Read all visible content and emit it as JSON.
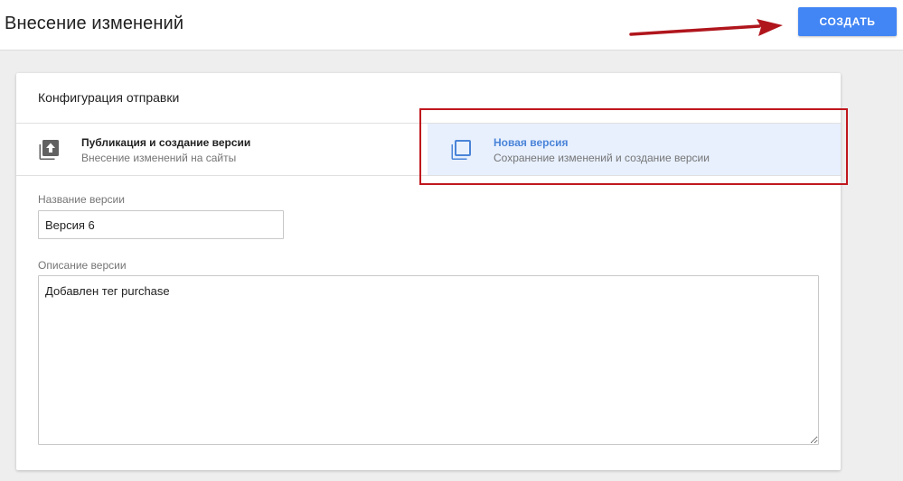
{
  "header": {
    "title": "Внесение изменений",
    "create_label": "СОЗДАТЬ"
  },
  "card": {
    "title": "Конфигурация отправки",
    "options": [
      {
        "title": "Публикация и создание версии",
        "subtitle": "Внесение изменений на сайты",
        "icon": "publish-upload-icon"
      },
      {
        "title": "Новая версия",
        "subtitle": "Сохранение изменений и создание версии",
        "icon": "new-version-icon",
        "selected": true
      }
    ],
    "version_name": {
      "label": "Название версии",
      "value": "Версия 6"
    },
    "version_description": {
      "label": "Описание версии",
      "value": "Добавлен тег purchase"
    }
  },
  "colors": {
    "accent": "#4285f4",
    "selected_bg": "#e8f0fe",
    "selected_text": "#4a84d8",
    "annotation": "#c0171e"
  }
}
